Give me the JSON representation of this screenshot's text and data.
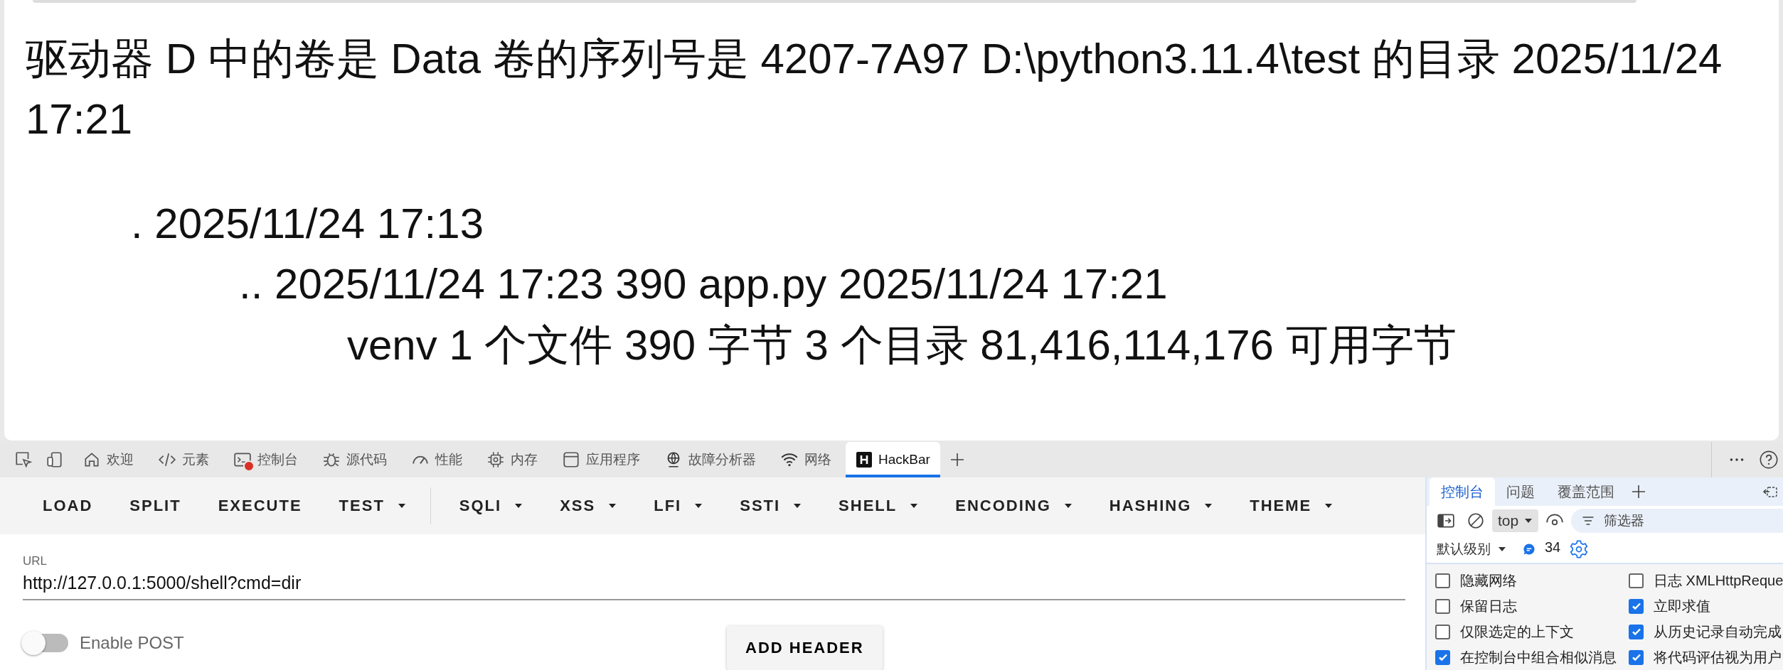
{
  "page": {
    "header_lines": [
      "驱动器 D 中的卷是 Data 卷的序列号是 4207-7A97 D:\\python3.11.4\\test 的目录 2025/11/24",
      "17:21"
    ],
    "listing": [
      {
        "text": ". 2025/11/24 17:13",
        "children": [
          {
            "text": ".. 2025/11/24 17:23 390 app.py 2025/11/24 17:21",
            "children": [
              {
                "text": "venv 1 个文件 390 字节 3 个目录 81,416,114,176 可用字节"
              }
            ]
          }
        ]
      }
    ]
  },
  "devtools": {
    "tabs": [
      {
        "label": "欢迎",
        "selected": false,
        "error": false
      },
      {
        "label": "元素",
        "selected": false,
        "error": false
      },
      {
        "label": "控制台",
        "selected": false,
        "error": true
      },
      {
        "label": "源代码",
        "selected": false,
        "error": false
      },
      {
        "label": "性能",
        "selected": false,
        "error": false
      },
      {
        "label": "内存",
        "selected": false,
        "error": false
      },
      {
        "label": "应用程序",
        "selected": false,
        "error": false
      },
      {
        "label": "故障分析器",
        "selected": false,
        "error": false
      },
      {
        "label": "网络",
        "selected": false,
        "error": false
      },
      {
        "label": "HackBar",
        "selected": true,
        "error": false
      }
    ]
  },
  "hackbar": {
    "menu_groups": [
      [
        {
          "label": "LOAD",
          "dropdown": false
        },
        {
          "label": "SPLIT",
          "dropdown": false
        },
        {
          "label": "EXECUTE",
          "dropdown": false
        },
        {
          "label": "TEST",
          "dropdown": true
        }
      ],
      [
        {
          "label": "SQLI",
          "dropdown": true
        },
        {
          "label": "XSS",
          "dropdown": true
        },
        {
          "label": "LFI",
          "dropdown": true
        },
        {
          "label": "SSTI",
          "dropdown": true
        },
        {
          "label": "SHELL",
          "dropdown": true
        },
        {
          "label": "ENCODING",
          "dropdown": true
        },
        {
          "label": "HASHING",
          "dropdown": true
        },
        {
          "label": "THEME",
          "dropdown": true
        }
      ]
    ],
    "url": {
      "label": "URL",
      "value": "http://127.0.0.1:5000/shell?cmd=dir"
    },
    "post_toggle": {
      "label": "Enable POST",
      "on": false
    },
    "add_header": "ADD HEADER"
  },
  "console": {
    "tabs": [
      {
        "label": "控制台",
        "selected": true
      },
      {
        "label": "问题",
        "selected": false
      },
      {
        "label": "覆盖范围",
        "selected": false
      }
    ],
    "context": "top",
    "filter": {
      "placeholder": "筛选器"
    },
    "level": "默认级别",
    "message_count": "34",
    "options": [
      {
        "label": "隐藏网络",
        "checked": false
      },
      {
        "label": "日志 XMLHttpReque",
        "checked": false
      },
      {
        "label": "保留日志",
        "checked": false
      },
      {
        "label": "立即求值",
        "checked": true
      },
      {
        "label": "仅限选定的上下文",
        "checked": false
      },
      {
        "label": "从历史记录自动完成",
        "checked": true
      },
      {
        "label": "在控制台中组合相似消息",
        "checked": true
      },
      {
        "label": "将代码评估视为用户",
        "checked": true
      }
    ]
  }
}
